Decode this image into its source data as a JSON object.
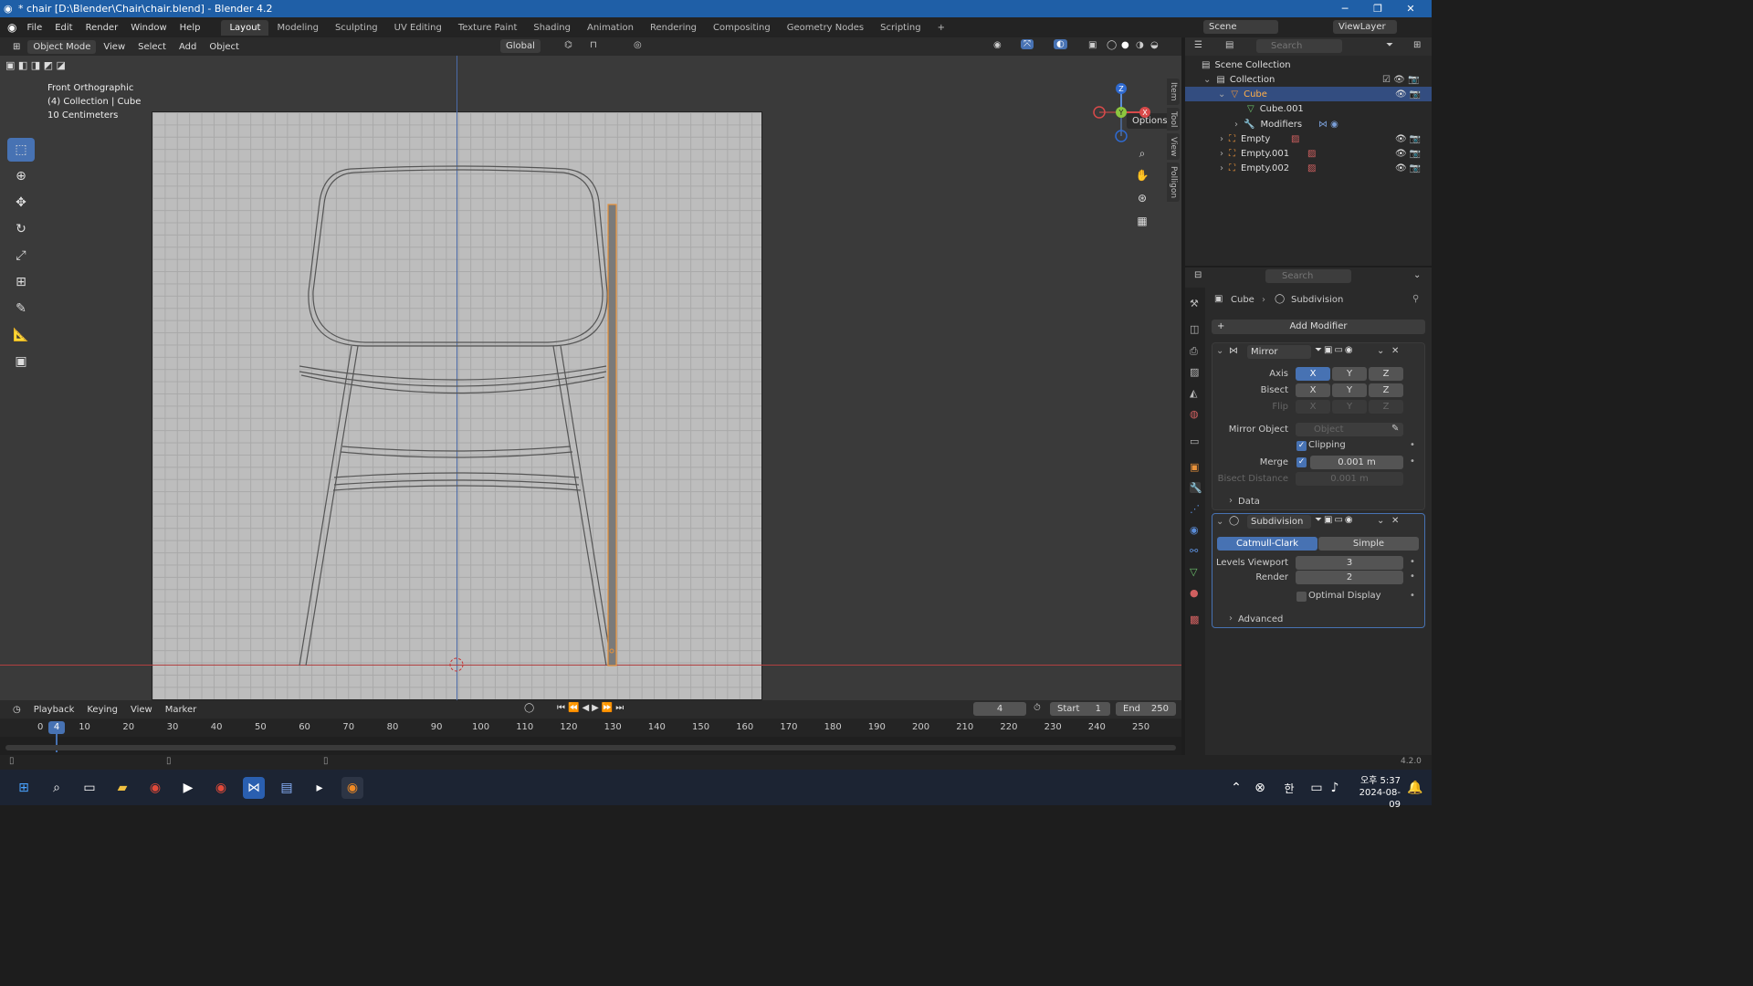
{
  "window": {
    "title": "* chair [D:\\Blender\\Chair\\chair.blend] - Blender 4.2"
  },
  "menu": {
    "items": [
      "File",
      "Edit",
      "Render",
      "Window",
      "Help"
    ]
  },
  "workspaces": {
    "tabs": [
      "Layout",
      "Modeling",
      "Sculpting",
      "UV Editing",
      "Texture Paint",
      "Shading",
      "Animation",
      "Rendering",
      "Compositing",
      "Geometry Nodes",
      "Scripting"
    ],
    "active": "Layout"
  },
  "scene": {
    "label": "Scene",
    "viewlayer": "ViewLayer"
  },
  "viewport_header": {
    "mode": "Object Mode",
    "menus": [
      "View",
      "Select",
      "Add",
      "Object"
    ],
    "transform": "Global",
    "options": "Options"
  },
  "viewport": {
    "view_name": "Front Orthographic",
    "collection": "(4) Collection | Cube",
    "scale": "10 Centimeters"
  },
  "side_tabs": [
    "Item",
    "Tool",
    "View",
    "Polligon"
  ],
  "gizmo": {
    "z": "Z",
    "y": "Y",
    "x": "X"
  },
  "timeline": {
    "menus": [
      "Playback",
      "Keying",
      "View",
      "Marker"
    ],
    "current": "4",
    "start_label": "Start",
    "start": "1",
    "end_label": "End",
    "end": "250",
    "ticks": [
      "0",
      "10",
      "20",
      "30",
      "40",
      "50",
      "60",
      "70",
      "80",
      "90",
      "100",
      "110",
      "120",
      "130",
      "140",
      "150",
      "160",
      "170",
      "180",
      "190",
      "200",
      "210",
      "220",
      "230",
      "240",
      "250"
    ],
    "marker": "4"
  },
  "status": {
    "version": "4.2.0"
  },
  "outliner": {
    "search": "Search",
    "scene_collection": "Scene Collection",
    "collection": "Collection",
    "items": [
      {
        "name": "Cube",
        "selected": true
      },
      {
        "name": "Cube.001"
      },
      {
        "name": "Modifiers"
      },
      {
        "name": "Empty"
      },
      {
        "name": "Empty.001"
      },
      {
        "name": "Empty.002"
      }
    ]
  },
  "properties": {
    "search": "Search",
    "breadcrumb_object": "Cube",
    "breadcrumb_modifier": "Subdivision",
    "add_modifier": "Add Modifier",
    "mirror": {
      "name": "Mirror",
      "axis_label": "Axis",
      "bisect_label": "Bisect",
      "flip_label": "Flip",
      "x": "X",
      "y": "Y",
      "z": "Z",
      "mirror_object_label": "Mirror Object",
      "mirror_object_placeholder": "Object",
      "clipping": "Clipping",
      "merge_label": "Merge",
      "merge_value": "0.001 m",
      "bisect_distance_label": "Bisect Distance",
      "bisect_distance_value": "0.001 m",
      "data": "Data"
    },
    "subdivision": {
      "name": "Subdivision",
      "catmull": "Catmull-Clark",
      "simple": "Simple",
      "levels_viewport_label": "Levels Viewport",
      "levels_viewport": "3",
      "render_label": "Render",
      "render": "2",
      "optimal_display": "Optimal Display",
      "advanced": "Advanced"
    }
  },
  "taskbar": {
    "time": "오후 5:37",
    "date": "2024-08-09",
    "ime": "한"
  }
}
